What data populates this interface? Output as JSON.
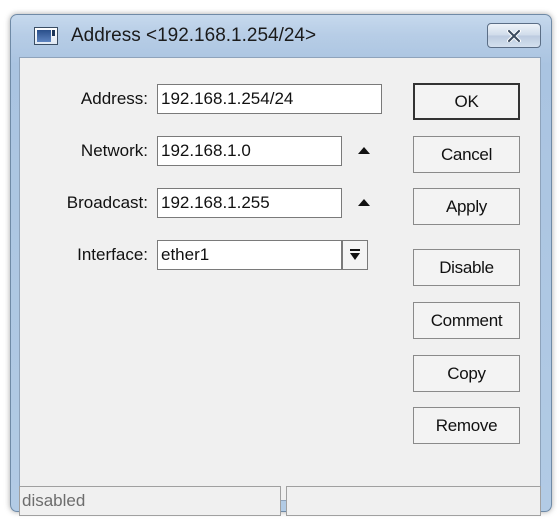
{
  "window": {
    "title": "Address <192.168.1.254/24>"
  },
  "form": {
    "address_label": "Address:",
    "address_value": "192.168.1.254/24",
    "network_label": "Network:",
    "network_value": "192.168.1.0",
    "broadcast_label": "Broadcast:",
    "broadcast_value": "192.168.1.255",
    "interface_label": "Interface:",
    "interface_value": "ether1"
  },
  "buttons": {
    "ok": "OK",
    "cancel": "Cancel",
    "apply": "Apply",
    "disable": "Disable",
    "comment": "Comment",
    "copy": "Copy",
    "remove": "Remove"
  },
  "status": {
    "left": "disabled",
    "right": ""
  },
  "icons": {
    "window": "window-icon",
    "close": "close-icon",
    "network_toggle": "arrow-up-icon",
    "broadcast_toggle": "arrow-up-icon",
    "interface_dropdown": "dropdown-arrow-icon"
  }
}
